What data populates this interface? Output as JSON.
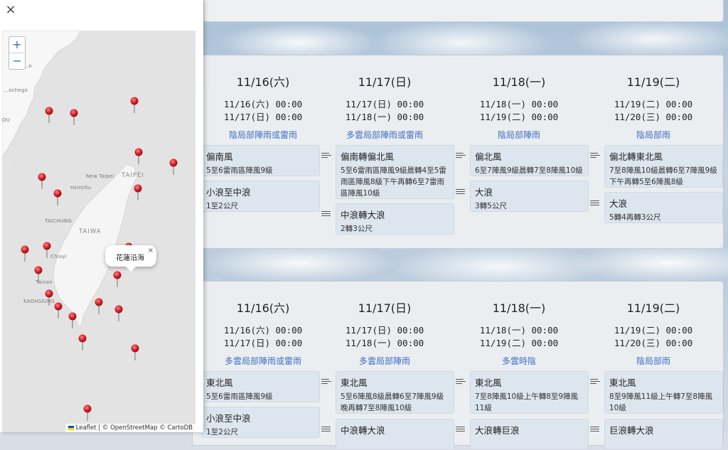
{
  "panel": {
    "close_icon": "×",
    "zoom_in": "+",
    "zoom_out": "−",
    "popup": {
      "title": "花蓮沿海",
      "close": "×"
    },
    "attribution": "Leaflet | © OpenStreetMap © CartoDB",
    "map_labels": {
      "xiamen": "Xiamen",
      "quanzhou": "Quanzhou",
      "new_taipei": "New Taipei",
      "taipei": "TAIPEI",
      "hsinchu": "Hsinchu",
      "taichung": "TAICHUNG",
      "taiwan": "TAIWA",
      "chiayi": "Chiayi",
      "tainan": "Tainan",
      "kaohsiung": "KAOHSIUNG",
      "fuzhou": "…ochego",
      "edge_n": "…n",
      "edge_ou": "OU"
    }
  },
  "cards": [
    {
      "cols": [
        {
          "date": "11/16(六)",
          "time1": "11/16(六) 00:00",
          "time2": "11/17(日) 00:00",
          "weather": "陰局部陣雨或雷雨",
          "wind_title": "偏南風",
          "wind_desc": "5至6雷雨區陣風9級",
          "wave_title": "小浪至中浪",
          "wave_desc": "1至2公尺"
        },
        {
          "date": "11/17(日)",
          "time1": "11/17(日) 00:00",
          "time2": "11/18(一) 00:00",
          "weather": "多雲局部陣雨或雷雨",
          "wind_title": "偏南轉偏北風",
          "wind_desc": "5至6雷雨區陣風9級晨轉4至5雷雨區陣風8級下午再轉6至7雷雨區陣風10級",
          "wave_title": "中浪轉大浪",
          "wave_desc": "2轉3公尺"
        },
        {
          "date": "11/18(一)",
          "time1": "11/18(一) 00:00",
          "time2": "11/19(二) 00:00",
          "weather": "陰局部陣雨",
          "wind_title": "偏北風",
          "wind_desc": "6至7陣風9級晨轉7至8陣風10級",
          "wave_title": "大浪",
          "wave_desc": "3轉5公尺"
        },
        {
          "date": "11/19(二)",
          "time1": "11/19(二) 00:00",
          "time2": "11/20(三) 00:00",
          "weather": "陰局部雨",
          "wind_title": "偏北轉東北風",
          "wind_desc": "7至8陣風10級晨轉6至7陣風9級下午再轉5至6陣風8級",
          "wave_title": "大浪",
          "wave_desc": "5轉4再轉3公尺"
        }
      ]
    },
    {
      "cols": [
        {
          "date": "11/16(六)",
          "time1": "11/16(六) 00:00",
          "time2": "11/17(日) 00:00",
          "weather": "多雲局部陣雨或雷雨",
          "wind_title": "東北風",
          "wind_desc": "5至6雷雨區陣風9級",
          "wave_title": "小浪至中浪",
          "wave_desc": "1至2公尺"
        },
        {
          "date": "11/17(日)",
          "time1": "11/17(日) 00:00",
          "time2": "11/18(一) 00:00",
          "weather": "多雲局部陣雨",
          "wind_title": "東北風",
          "wind_desc": "5至6陣風8級晨轉6至7陣風9級晚再轉7至8陣風10級",
          "wave_title": "中浪轉大浪",
          "wave_desc": ""
        },
        {
          "date": "11/18(一)",
          "time1": "11/18(一) 00:00",
          "time2": "11/19(二) 00:00",
          "weather": "多雲時陰",
          "wind_title": "東北風",
          "wind_desc": "7至8陣風10級上午轉8至9陣風11級",
          "wave_title": "大浪轉巨浪",
          "wave_desc": ""
        },
        {
          "date": "11/19(二)",
          "time1": "11/19(二) 00:00",
          "time2": "11/20(三) 00:00",
          "weather": "陰局部雨",
          "wind_title": "東北風",
          "wind_desc": "8至9陣風11級上午轉7至8陣風10級",
          "wave_title": "巨浪轉大浪",
          "wave_desc": ""
        }
      ]
    }
  ]
}
